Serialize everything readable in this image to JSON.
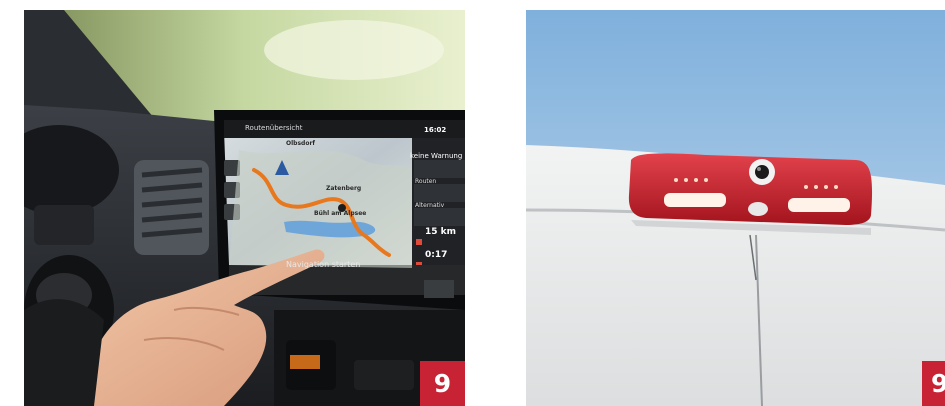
{
  "photos": {
    "left": {
      "badge": "9",
      "screen": {
        "header": "Routenübersicht",
        "time": "16:02",
        "warning": "keine Warnung",
        "routes": "Routen",
        "alternatives": "Alternativ",
        "distance": "15 km",
        "eta": "0:17",
        "start_button": "Navigation starten",
        "map_labels": [
          "Olbsdorf",
          "Zatenberg",
          "Bühl am Alpsee"
        ]
      }
    },
    "right": {
      "badge": "9"
    }
  },
  "colors": {
    "badge": "#c72335",
    "third_brake_light": "#c81e2b",
    "route_line": "#e8781e",
    "sky": "#9fc3e0"
  }
}
